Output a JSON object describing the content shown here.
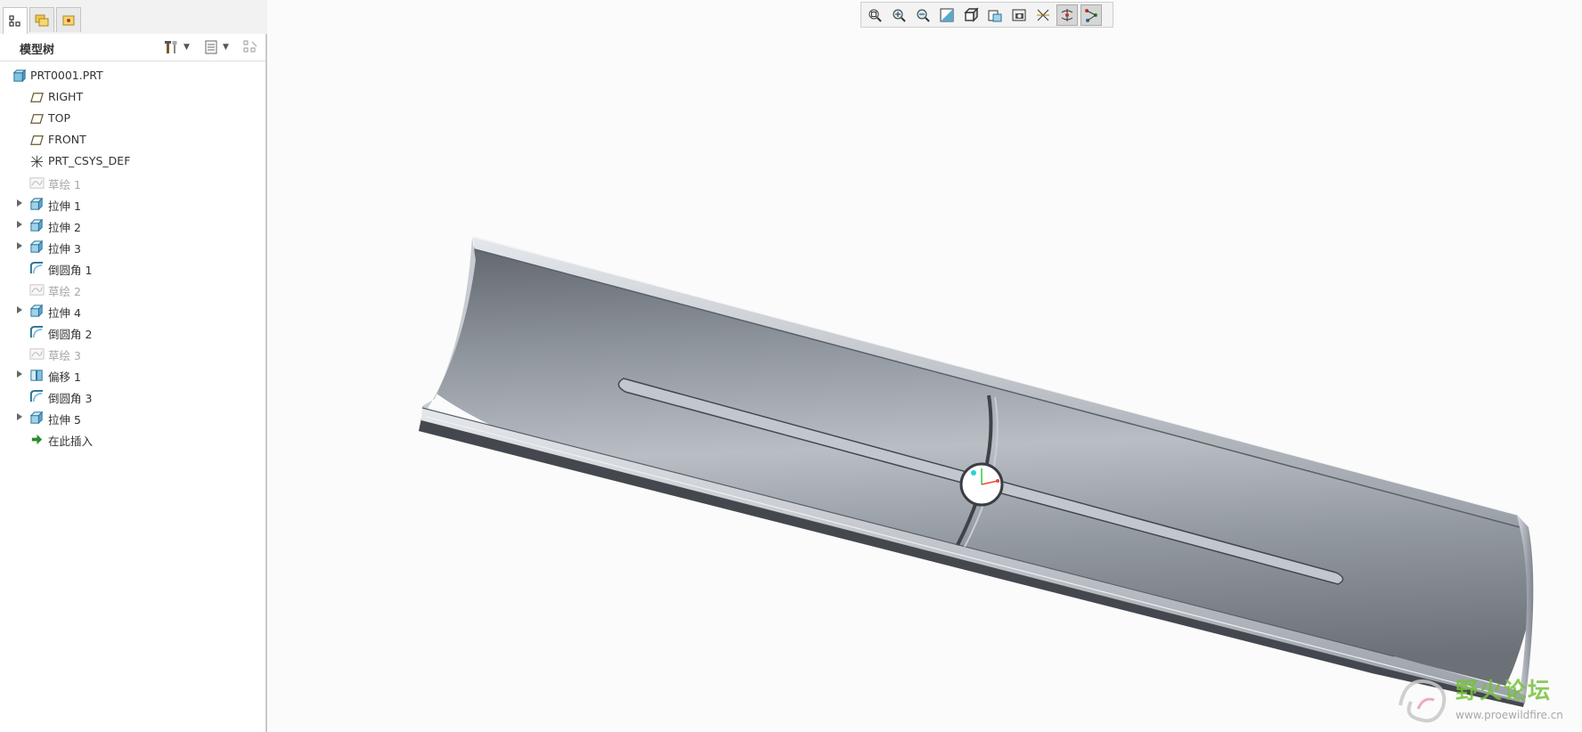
{
  "panel": {
    "title": "模型树",
    "tabs": [
      {
        "icon": "model-tree-icon",
        "active": true
      },
      {
        "icon": "folder-browser-icon",
        "active": false
      },
      {
        "icon": "favorites-icon",
        "active": false
      }
    ]
  },
  "tree": {
    "items": [
      {
        "label": "PRT0001.PRT",
        "icon": "part-icon",
        "expandable": false,
        "dim": false,
        "indent": 0
      },
      {
        "label": "RIGHT",
        "icon": "datum-plane-icon",
        "expandable": false,
        "dim": false,
        "indent": 1
      },
      {
        "label": "TOP",
        "icon": "datum-plane-icon",
        "expandable": false,
        "dim": false,
        "indent": 1
      },
      {
        "label": "FRONT",
        "icon": "datum-plane-icon",
        "expandable": false,
        "dim": false,
        "indent": 1
      },
      {
        "label": "PRT_CSYS_DEF",
        "icon": "coordinate-system-icon",
        "expandable": false,
        "dim": false,
        "indent": 1
      },
      {
        "label": "草绘 1",
        "icon": "sketch-icon",
        "expandable": false,
        "dim": true,
        "indent": 1
      },
      {
        "label": "拉伸 1",
        "icon": "extrude-icon",
        "expandable": true,
        "dim": false,
        "indent": 1
      },
      {
        "label": "拉伸 2",
        "icon": "extrude-icon",
        "expandable": true,
        "dim": false,
        "indent": 1
      },
      {
        "label": "拉伸 3",
        "icon": "extrude-icon",
        "expandable": true,
        "dim": false,
        "indent": 1
      },
      {
        "label": "倒圆角 1",
        "icon": "round-icon",
        "expandable": false,
        "dim": false,
        "indent": 1
      },
      {
        "label": "草绘 2",
        "icon": "sketch-icon",
        "expandable": false,
        "dim": true,
        "indent": 1
      },
      {
        "label": "拉伸 4",
        "icon": "extrude-icon",
        "expandable": true,
        "dim": false,
        "indent": 1
      },
      {
        "label": "倒圆角 2",
        "icon": "round-icon",
        "expandable": false,
        "dim": false,
        "indent": 1
      },
      {
        "label": "草绘 3",
        "icon": "sketch-icon",
        "expandable": false,
        "dim": true,
        "indent": 1
      },
      {
        "label": "偏移 1",
        "icon": "offset-icon",
        "expandable": true,
        "dim": false,
        "indent": 1
      },
      {
        "label": "倒圆角 3",
        "icon": "round-icon",
        "expandable": false,
        "dim": false,
        "indent": 1
      },
      {
        "label": "拉伸 5",
        "icon": "extrude-icon",
        "expandable": true,
        "dim": false,
        "indent": 1
      },
      {
        "label": "在此插入",
        "icon": "insert-here-arrow-icon",
        "expandable": false,
        "dim": false,
        "indent": 1
      }
    ]
  },
  "toolbar": {
    "buttons": [
      {
        "icon": "refit-icon",
        "pressed": false
      },
      {
        "icon": "zoom-in-icon",
        "pressed": false
      },
      {
        "icon": "zoom-out-icon",
        "pressed": false
      },
      {
        "icon": "repaint-icon",
        "pressed": false
      },
      {
        "icon": "display-style-icon",
        "pressed": false
      },
      {
        "icon": "saved-orientations-icon",
        "pressed": false
      },
      {
        "icon": "view-manager-icon",
        "pressed": false
      },
      {
        "icon": "datum-display-icon",
        "pressed": false
      },
      {
        "icon": "spin-center-icon",
        "pressed": true
      },
      {
        "icon": "annotation-display-icon",
        "pressed": true
      }
    ]
  },
  "colors": {
    "model_body": "#8d939b",
    "model_highlight": "#d7dbe0",
    "model_shadow": "#4c5057",
    "watermark_green": "#77c23a"
  },
  "watermark": {
    "text": "野火论坛",
    "url": "www.proewildfire.cn"
  }
}
